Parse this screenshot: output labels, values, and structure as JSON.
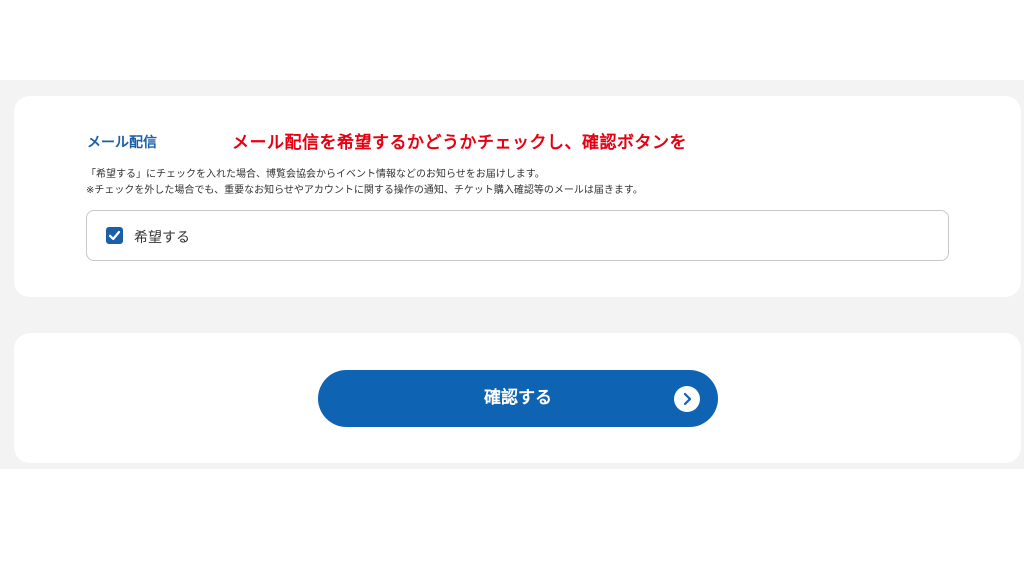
{
  "mail_section": {
    "title": "メール配信",
    "annotation": "メール配信を希望するかどうかチェックし、確認ボタンを",
    "description_line1": "「希望する」にチェックを入れた場合、博覧会協会からイベント情報などのお知らせをお届けします。",
    "description_line2": "※チェックを外した場合でも、重要なお知らせやアカウントに関する操作の通知、チケット購入確認等のメールは届きます。",
    "checkbox": {
      "label": "希望する",
      "checked": true
    }
  },
  "confirm": {
    "button_label": "確認する",
    "icon": "chevron-right-circle-icon"
  },
  "colors": {
    "accent": "#0f63b3",
    "title": "#1a5fa8",
    "annotation": "#e60012",
    "band": "#f3f3f3"
  }
}
